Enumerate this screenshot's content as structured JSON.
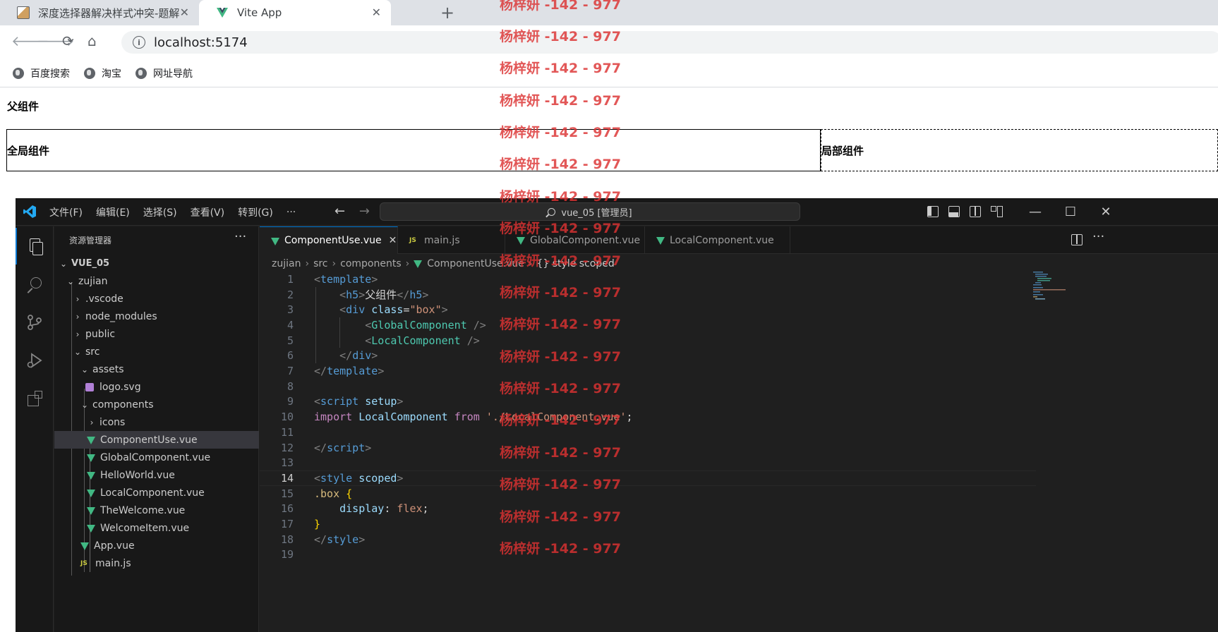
{
  "browser": {
    "tabs": [
      {
        "title": "深度选择器解决样式冲突-题解",
        "close": "✕"
      },
      {
        "title": "Vite App",
        "close": "✕"
      }
    ],
    "new_tab": "+",
    "url": "localhost:5174",
    "bookmarks": [
      "百度搜索",
      "淘宝",
      "网址导航"
    ]
  },
  "page": {
    "parent_heading": "父组件",
    "global_component": "全局组件",
    "local_component": "局部组件"
  },
  "vscode": {
    "menu": [
      "文件(F)",
      "编辑(E)",
      "选择(S)",
      "查看(V)",
      "转到(G)",
      "···"
    ],
    "command_center": "vue_05 [管理员]",
    "explorer_title": "资源管理器",
    "explorer_more": "···",
    "tree": [
      {
        "label": "VUE_05",
        "chev": "⌄"
      },
      {
        "label": "zujian",
        "chev": "⌄"
      },
      {
        "label": ".vscode",
        "chev": "›"
      },
      {
        "label": "node_modules",
        "chev": "›"
      },
      {
        "label": "public",
        "chev": "›"
      },
      {
        "label": "src",
        "chev": "⌄"
      },
      {
        "label": "assets",
        "chev": "⌄"
      },
      {
        "label": "logo.svg"
      },
      {
        "label": "components",
        "chev": "⌄"
      },
      {
        "label": "icons",
        "chev": "›"
      },
      {
        "label": "ComponentUse.vue"
      },
      {
        "label": "GlobalComponent.vue"
      },
      {
        "label": "HelloWorld.vue"
      },
      {
        "label": "LocalComponent.vue"
      },
      {
        "label": "TheWelcome.vue"
      },
      {
        "label": "WelcomeItem.vue"
      },
      {
        "label": "App.vue"
      },
      {
        "label": "main.js",
        "icon": "JS"
      }
    ],
    "editor_tabs": [
      {
        "label": "ComponentUse.vue",
        "close": "✕"
      },
      {
        "label": "main.js",
        "icon": "JS"
      },
      {
        "label": "GlobalComponent.vue"
      },
      {
        "label": "LocalComponent.vue"
      }
    ],
    "breadcrumbs": [
      "zujian",
      "src",
      "components",
      "ComponentUse.vue",
      "{} style scoped"
    ],
    "code": {
      "l1a": "<",
      "l1b": "template",
      "l1c": ">",
      "l2a": "<",
      "l2b": "h5",
      "l2c": ">",
      "l2d": "父组件",
      "l2e": "</",
      "l2f": "h5",
      "l2g": ">",
      "l3a": "<",
      "l3b": "div",
      "l3c": " class",
      "l3d": "=",
      "l3e": "\"box\"",
      "l3f": ">",
      "l4a": "<",
      "l4b": "GlobalComponent",
      "l4c": " />",
      "l5a": "<",
      "l5b": "LocalComponent",
      "l5c": " />",
      "l6a": "</",
      "l6b": "div",
      "l6c": ">",
      "l7a": "</",
      "l7b": "template",
      "l7c": ">",
      "l9a": "<",
      "l9b": "script",
      "l9c": " setup",
      "l9d": ">",
      "l10a": "import",
      "l10b": " LocalComponent ",
      "l10c": "from",
      "l10d": " './LocalComponent.vue'",
      "l10e": ";",
      "l12a": "</",
      "l12b": "script",
      "l12c": ">",
      "l14a": "<",
      "l14b": "style",
      "l14c": " scoped",
      "l14d": ">",
      "l15a": ".box",
      "l15b": " {",
      "l16a": "display",
      "l16b": ": ",
      "l16c": "flex",
      "l16d": ";",
      "l17a": "}",
      "l18a": "</",
      "l18b": "style",
      "l18c": ">"
    },
    "line_numbers": [
      "1",
      "2",
      "3",
      "4",
      "5",
      "6",
      "7",
      "8",
      "9",
      "10",
      "11",
      "12",
      "13",
      "14",
      "15",
      "16",
      "17",
      "18",
      "19"
    ]
  },
  "watermark": "杨梓妍 -142 - 977"
}
